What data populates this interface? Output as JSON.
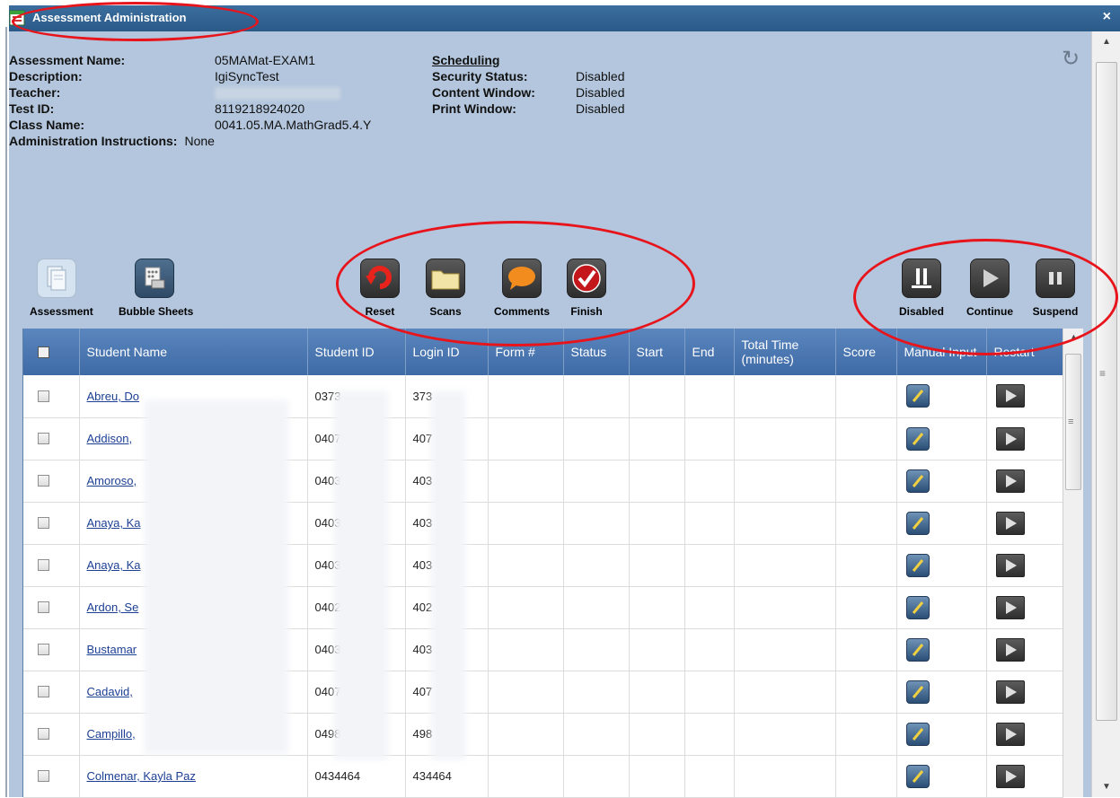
{
  "window": {
    "title": "Assessment Administration",
    "close_glyph": "×"
  },
  "info": {
    "assessment_name_label": "Assessment Name:",
    "assessment_name": "05MAMat-EXAM1",
    "description_label": "Description:",
    "description": "IgiSyncTest",
    "teacher_label": "Teacher:",
    "teacher": "",
    "test_id_label": "Test ID:",
    "test_id": "8119218924020",
    "class_name_label": "Class Name:",
    "class_name": "0041.05.MA.MathGrad5.4.Y",
    "admin_instructions_label": "Administration Instructions:",
    "admin_instructions": "None"
  },
  "scheduling": {
    "heading": "Scheduling",
    "security_label": "Security Status:",
    "security": "Disabled",
    "content_window_label": "Content Window:",
    "content_window": "Disabled",
    "print_window_label": "Print Window:",
    "print_window": "Disabled"
  },
  "toolbar": {
    "assessment": "Assessment",
    "bubble_sheets": "Bubble Sheets",
    "reset": "Reset",
    "scans": "Scans",
    "comments": "Comments",
    "finish": "Finish",
    "disabled": "Disabled",
    "continue": "Continue",
    "suspend": "Suspend"
  },
  "table": {
    "headers": {
      "student_name": "Student Name",
      "student_id": "Student ID",
      "login_id": "Login ID",
      "form": "Form #",
      "status": "Status",
      "start": "Start",
      "end": "End",
      "total_time": "Total Time (minutes)",
      "score": "Score",
      "manual_input": "Manual Input",
      "restart": "Restart"
    },
    "rows": [
      {
        "name": "Abreu, Do",
        "student_id": "0373",
        "login_id": "373"
      },
      {
        "name": "Addison,",
        "student_id": "0407",
        "login_id": "407"
      },
      {
        "name": "Amoroso,",
        "student_id": "0403",
        "login_id": "403"
      },
      {
        "name": "Anaya, Ka",
        "student_id": "0403",
        "login_id": "403"
      },
      {
        "name": "Anaya, Ka",
        "student_id": "0403",
        "login_id": "403"
      },
      {
        "name": "Ardon, Se",
        "student_id": "0402",
        "login_id": "402"
      },
      {
        "name": "Bustamar",
        "student_id": "0403",
        "login_id": "403"
      },
      {
        "name": "Cadavid,",
        "student_id": "0407",
        "login_id": "407"
      },
      {
        "name": "Campillo,",
        "student_id": "0498",
        "login_id": "498"
      },
      {
        "name": "Colmenar, Kayla Paz",
        "student_id": "0434464",
        "login_id": "434464"
      }
    ]
  },
  "colors": {
    "titlebar": "#2a5a88",
    "panel": "#b3c6dd",
    "header": "#4a76b0",
    "annotation": "#e8141c",
    "link": "#1c3f94"
  }
}
